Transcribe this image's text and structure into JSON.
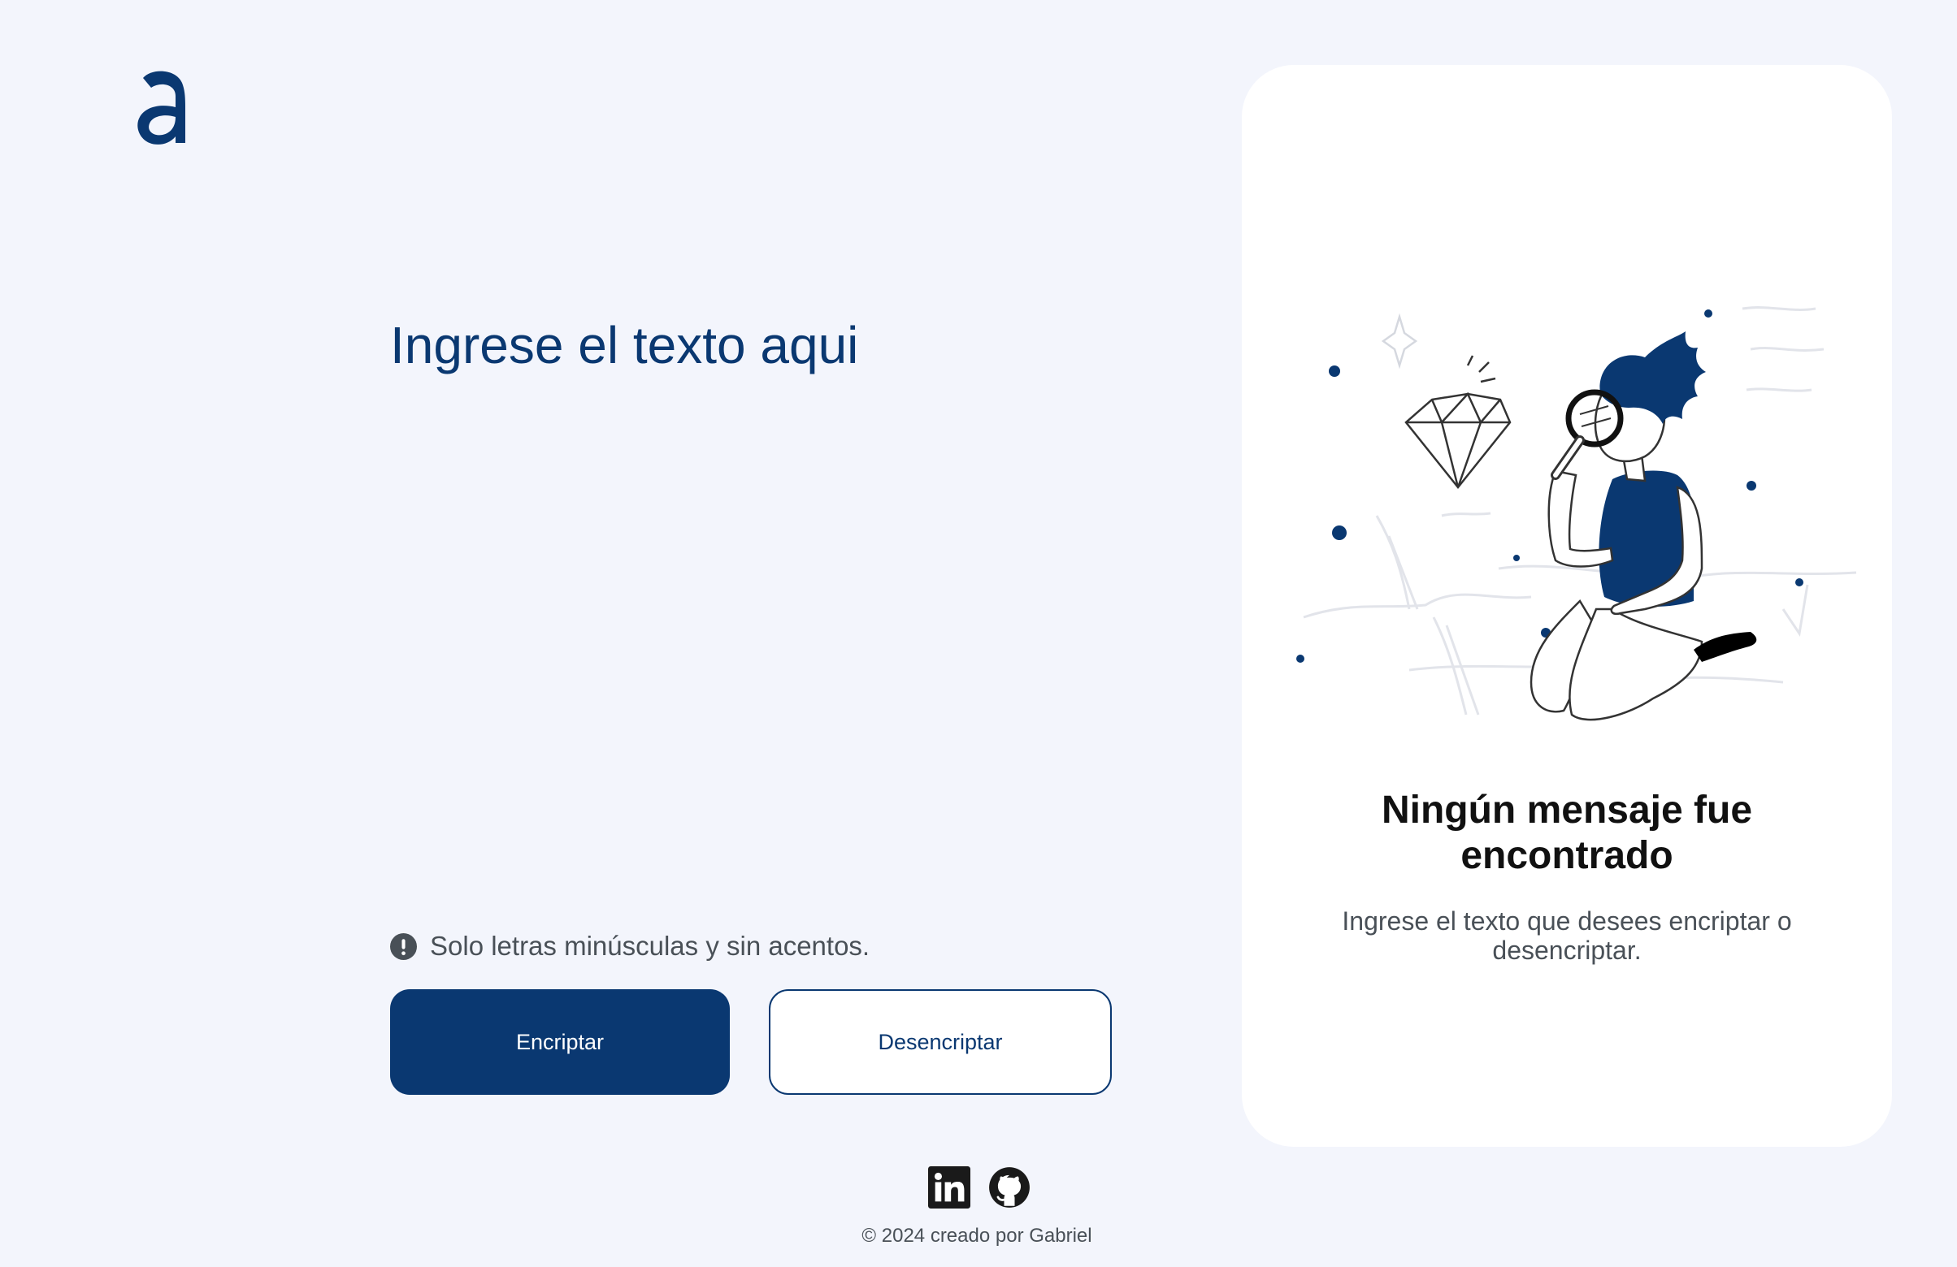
{
  "app": {
    "logo_icon": "alura-a-logo-icon",
    "accent_color": "#0a3871"
  },
  "input": {
    "placeholder": "Ingrese el texto aqui",
    "value": ""
  },
  "hint": {
    "icon": "exclamation-circle-icon",
    "text": "Solo letras minúsculas y sin acentos."
  },
  "buttons": {
    "encrypt_label": "Encriptar",
    "decrypt_label": "Desencriptar"
  },
  "output": {
    "illustration": "person-with-magnifier-illustration",
    "title": "Ningún mensaje fue encontrado",
    "description": "Ingrese el texto que desees encriptar o desencriptar."
  },
  "footer": {
    "links": [
      {
        "icon": "linkedin-icon",
        "label": "LinkedIn"
      },
      {
        "icon": "github-icon",
        "label": "GitHub"
      }
    ],
    "copyright": "© 2024 creado por Gabriel"
  }
}
